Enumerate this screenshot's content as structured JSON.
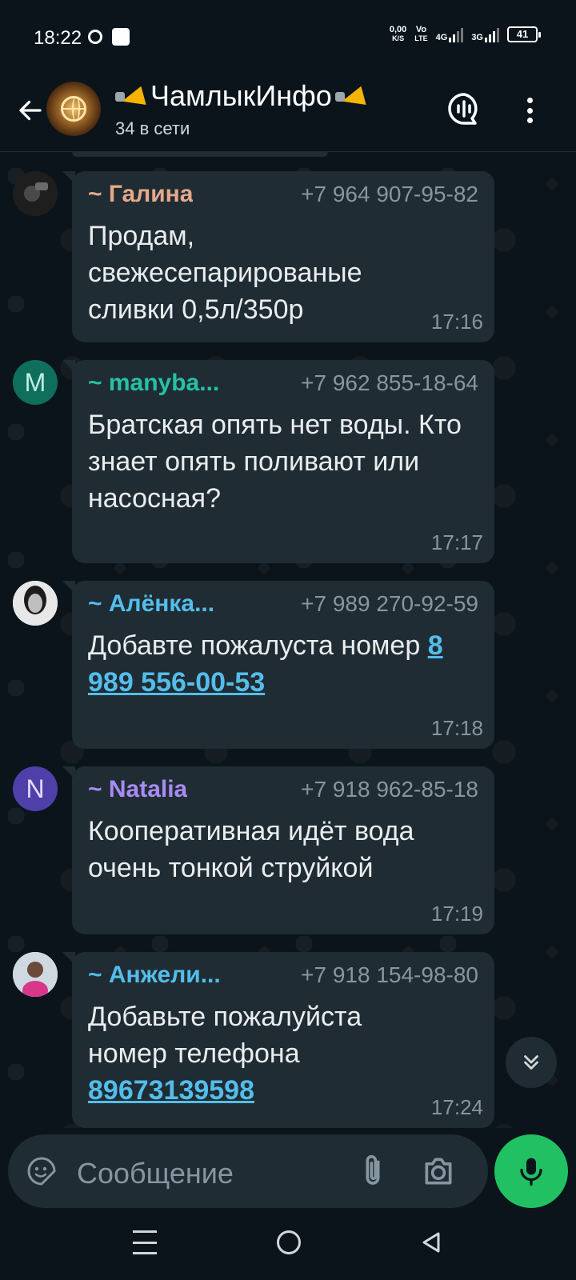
{
  "status_bar": {
    "time": "18:22",
    "net_speed_value": "0,00",
    "net_speed_unit": "K/S",
    "volte": "Vo",
    "volte_sub": "LTE",
    "network1": "4G",
    "network2": "3G",
    "battery": "41"
  },
  "header": {
    "title": "ЧамлыкИнфо",
    "subtitle": "34 в сети",
    "title_icon": "megaphone-icon"
  },
  "messages": [
    {
      "sender": "~ Галина",
      "sender_color": "#e4a98a",
      "phone": "+7 964 907-95-82",
      "text": "Продам, свежесепарированые сливки 0,5л/350р",
      "link": "",
      "time": "17:16",
      "avatar_initial": "",
      "avatar_color": "#3a3a3a"
    },
    {
      "sender": "~ manyba...",
      "sender_color": "#25c1a6",
      "phone": "+7 962 855-18-64",
      "text": "Братская опять нет воды. Кто знает опять поливают или насосная?",
      "link": "",
      "time": "17:17",
      "avatar_initial": "M",
      "avatar_color": "#0f6e5c"
    },
    {
      "sender": "~ Алёнка...",
      "sender_color": "#53bdeb",
      "phone": "+7 989 270-92-59",
      "text": "Добавте пожалуста номер ",
      "link": "8 989 556-00-53",
      "time": "17:18",
      "avatar_initial": "",
      "avatar_color": "#e0e0e0"
    },
    {
      "sender": "~ Natalia",
      "sender_color": "#a88bf5",
      "phone": "+7 918 962-85-18",
      "text": "Кооперативная идёт вода очень тонкой струйкой",
      "link": "",
      "time": "17:19",
      "avatar_initial": "N",
      "avatar_color": "#4f3fa8"
    },
    {
      "sender": "~ Анжели...",
      "sender_color": "#53bdeb",
      "phone": "+7 918 154-98-80",
      "text": "Добавьте пожалуйста номер телефона ",
      "link": "89673139598",
      "time": "17:24",
      "avatar_initial": "",
      "avatar_color": "#c9d6e0"
    }
  ],
  "input": {
    "placeholder": "Сообщение"
  },
  "colors": {
    "background": "#0b141a",
    "bubble": "#202c33",
    "accent_green": "#21c063",
    "link": "#53bdeb"
  }
}
